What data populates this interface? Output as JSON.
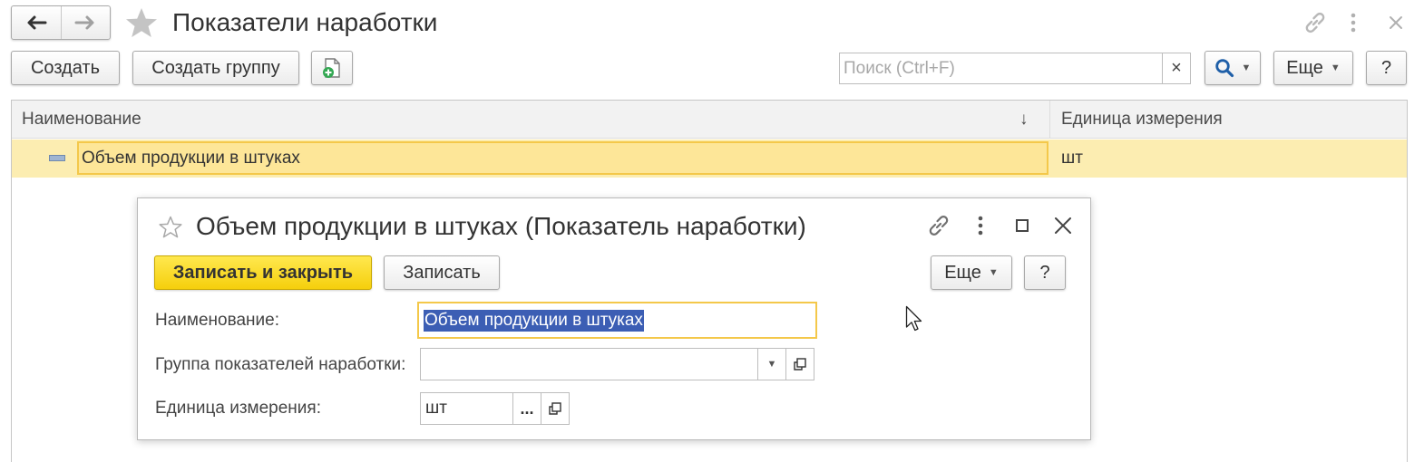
{
  "window": {
    "title": "Показатели наработки"
  },
  "toolbar": {
    "create_label": "Создать",
    "create_group_label": "Создать группу",
    "search_placeholder": "Поиск (Ctrl+F)",
    "search_clear_symbol": "×",
    "more_label": "Еще",
    "help_label": "?"
  },
  "table": {
    "columns": [
      {
        "label": "Наименование",
        "sort_indicator": "↓"
      },
      {
        "label": "Единица измерения"
      }
    ],
    "rows": [
      {
        "name": "Объем продукции в штуках",
        "unit": "шт",
        "selected": true
      }
    ]
  },
  "dialog": {
    "title": "Объем продукции в штуках (Показатель наработки)",
    "save_close_label": "Записать и закрыть",
    "save_label": "Записать",
    "more_label": "Еще",
    "help_label": "?",
    "fields": {
      "name_label": "Наименование:",
      "name_value": "Объем продукции в штуках",
      "group_label": "Группа показателей наработки:",
      "group_value": "",
      "unit_label": "Единица измерения:",
      "unit_value": "шт",
      "unit_select_symbol": "..."
    }
  },
  "icons": {
    "back": "arrow-left-icon",
    "forward": "arrow-right-icon",
    "favorite": "star-icon",
    "link": "link-icon",
    "menu": "more-vertical-icon",
    "close": "close-icon",
    "maximize": "maximize-icon",
    "search": "search-icon",
    "add_document": "add-document-icon",
    "open": "open-form-icon",
    "dropdown": "chevron-down-icon"
  },
  "colors": {
    "accent_yellow": "#f5cf0c",
    "selected_row": "#fcedb1",
    "selected_cell_border": "#f4c84a",
    "text_selection": "#3c5eb4",
    "search_icon": "#1f5fa8"
  }
}
